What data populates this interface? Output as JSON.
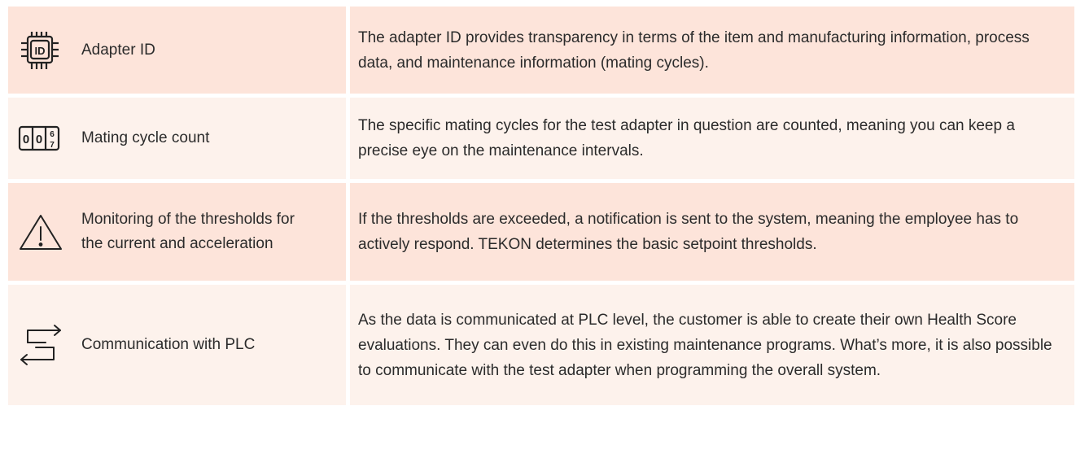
{
  "rows": [
    {
      "icon": "adapter-id-chip-icon",
      "label": "Adapter ID",
      "description": "The adapter ID provides transparency in terms of the item and manufacturing information, process data, and maintenance information (mating cycles)."
    },
    {
      "icon": "counter-icon",
      "counter_digits": [
        "0",
        "0",
        "6",
        "7"
      ],
      "label": "Mating cycle count",
      "description": "The specific mating cycles for the test adapter in question are counted, meaning you can keep a precise eye on the maintenance intervals."
    },
    {
      "icon": "warning-triangle-icon",
      "label": "Monitoring of the thresholds for the current and acceleration",
      "description": "If the thresholds are exceeded, a notification is sent to the system, meaning the employee has to actively respond. TEKON determines the basic setpoint thresholds."
    },
    {
      "icon": "exchange-arrows-icon",
      "label": "Communication with PLC",
      "description": "As the data is communicated at PLC level, the customer is able to create their own Health Score evaluations. They can even do this in existing maintenance programs. What’s more, it is also possible to communicate with the test adapter when programming the overall system."
    }
  ],
  "colors": {
    "row_dark": "#fde4da",
    "row_light": "#fdf2ec",
    "text": "#2b2b2b"
  }
}
